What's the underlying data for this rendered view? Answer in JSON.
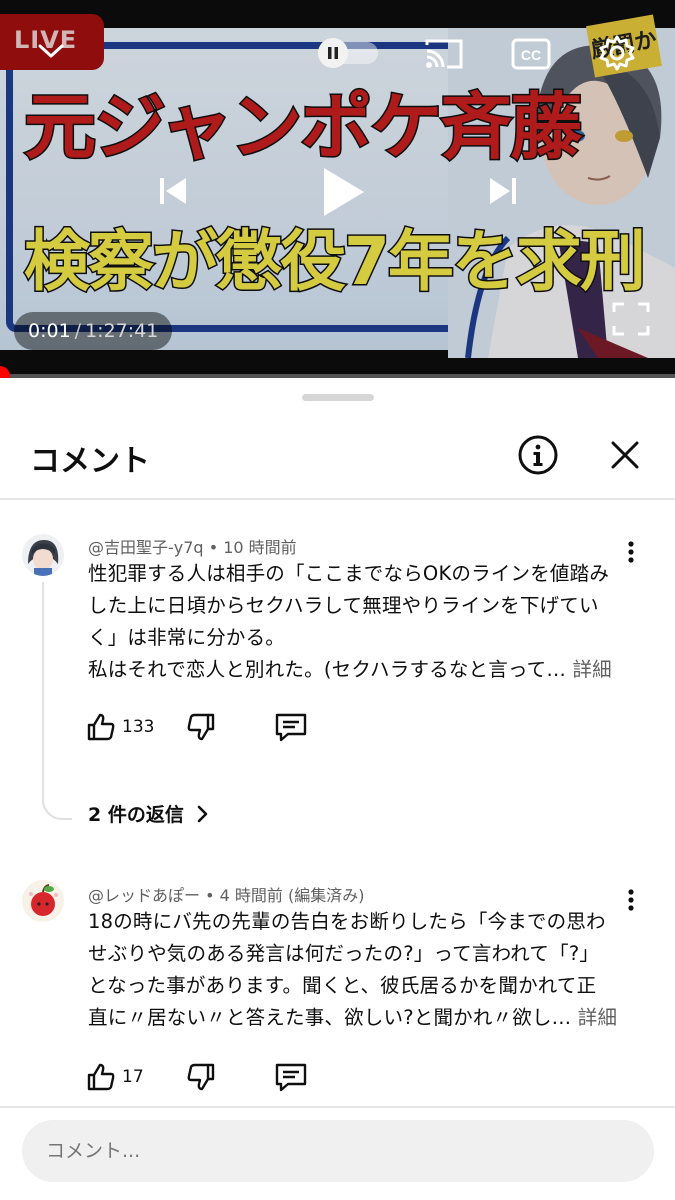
{
  "player": {
    "live_badge": "LIVE",
    "headline_line1": "元ジャンポケ斉藤",
    "headline_line2": "検察が懲役7年を求刑",
    "stamp_text": "厳罰か",
    "time_current": "0:01",
    "time_separator": "/",
    "time_total": "1:27:41",
    "progress_fraction": 0.0002,
    "autoplay_on": false,
    "icons": {
      "collapse": "chevron-down-icon",
      "autoplay": "pause-icon",
      "cast": "cast-icon",
      "captions": "cc-icon",
      "settings": "gear-icon",
      "previous": "skip-previous-icon",
      "play": "play-icon",
      "next": "skip-next-icon",
      "fullscreen": "fullscreen-icon"
    },
    "captions_label": "CC"
  },
  "comments_sheet": {
    "title": "コメント",
    "info_icon": "info-icon",
    "close_icon": "close-icon",
    "comments": [
      {
        "author": "@吉田聖子-y7q",
        "separator": "•",
        "time": "10 時間前",
        "lines": [
          "性犯罪する人は相手の「ここまでならOKのラインを値踏み",
          "した上に日頃からセクハラして無理やりラインを下げてい",
          "く」は非常に分かる。",
          "私はそれで恋人と別れた。(セクハラするなと言って…"
        ],
        "read_more": "詳細",
        "likes": "133",
        "replies_label": "2 件の返信"
      },
      {
        "author": "@レッドあぽー",
        "separator": "•",
        "time": "4 時間前 (編集済み)",
        "lines": [
          "18の時にバ先の先輩の告白をお断りしたら「今までの思わ",
          "せぶりや気のある発言は何だったの?」って言われて「?」",
          "となった事があります。聞くと、彼氏居るかを聞かれて正",
          "直に〃居ない〃と答えた事、欲しい?と聞かれ〃欲し…"
        ],
        "read_more": "詳細",
        "likes": "17"
      }
    ],
    "composer": {
      "placeholder": "コメント..."
    }
  },
  "colors": {
    "accent_red": "#ff0000",
    "text_primary": "#0f0f0f",
    "text_secondary": "#606060",
    "input_bg": "#f0f0f0"
  }
}
